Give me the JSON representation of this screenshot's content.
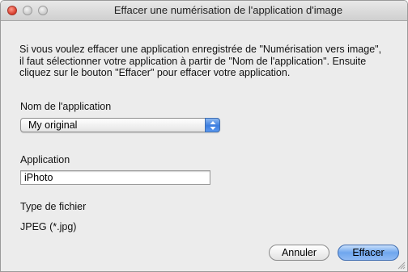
{
  "window": {
    "title": "Effacer une numérisation de l'application d'image"
  },
  "description": "Si vous voulez effacer une application enregistrée de \"Numérisation vers image\", il faut sélectionner votre application à partir de \"Nom de l'application\". Ensuite cliquez sur le bouton \"Effacer\" pour effacer votre application.",
  "app_name": {
    "label": "Nom de l'application",
    "selected": "My original"
  },
  "application": {
    "label": "Application",
    "value": "iPhoto"
  },
  "file_type": {
    "label": "Type de fichier",
    "value": "JPEG (*.jpg)"
  },
  "buttons": {
    "cancel": "Annuler",
    "delete": "Effacer"
  },
  "colors": {
    "close_button": "#d63a2a",
    "accent_blue": "#3c7de0",
    "window_background": "#ececec"
  }
}
